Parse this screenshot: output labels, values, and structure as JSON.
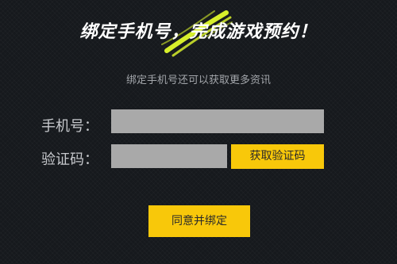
{
  "dialog": {
    "title": "绑定手机号，完成游戏预约！",
    "subtitle": "绑定手机号还可以获取更多资讯"
  },
  "form": {
    "phone_label": "手机号：",
    "phone_value": "",
    "code_label": "验证码：",
    "code_value": "",
    "get_code_label": "获取验证码",
    "confirm_label": "同意并绑定"
  },
  "colors": {
    "background": "#16191d",
    "accent": "#f8c80a",
    "brush": "#d7ef2b",
    "input_fill": "#a9a9a9"
  }
}
